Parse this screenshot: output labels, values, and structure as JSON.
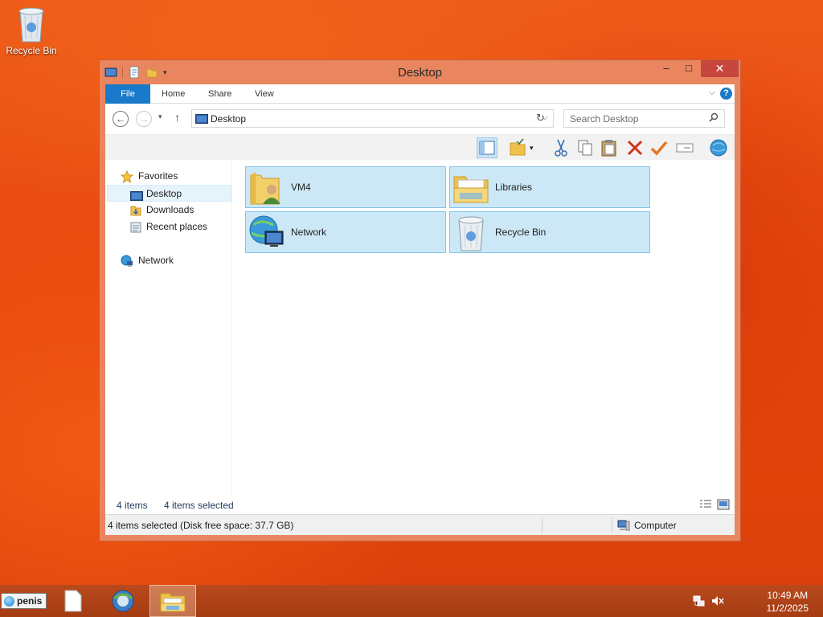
{
  "desktop": {
    "icons": [
      {
        "label": "Recycle Bin",
        "icon": "recycle-bin-icon"
      }
    ]
  },
  "window": {
    "title": "Desktop",
    "controls": {
      "minimize": "–",
      "maximize": "□",
      "close": "✕"
    },
    "ribbon": {
      "tabs": [
        "File",
        "Home",
        "Share",
        "View"
      ],
      "help": "?",
      "expand": "⌵"
    },
    "nav": {
      "back": "←",
      "forward": "→",
      "recent": "▾",
      "up": "↑",
      "address": "Desktop",
      "search_placeholder": "Search Desktop"
    },
    "sidebar": {
      "items": [
        {
          "label": "Favorites",
          "icon": "star-icon"
        },
        {
          "label": "Desktop",
          "icon": "desktop-icon",
          "selected": true
        },
        {
          "label": "Downloads",
          "icon": "downloads-icon"
        },
        {
          "label": "Recent places",
          "icon": "recent-places-icon"
        },
        {
          "label": "Network",
          "icon": "network-icon"
        }
      ]
    },
    "items": [
      {
        "name": "VM4",
        "icon": "user-folder-icon",
        "selected": true
      },
      {
        "name": "Libraries",
        "icon": "libraries-icon",
        "selected": true
      },
      {
        "name": "Network",
        "icon": "network-globe-icon",
        "selected": true
      },
      {
        "name": "Recycle Bin",
        "icon": "recycle-bin-icon",
        "selected": true
      }
    ],
    "status": {
      "count": "4 items",
      "selected": "4 items selected",
      "detail": "4 items selected (Disk free space: 37.7 GB)",
      "zone": "Computer"
    }
  },
  "taskbar": {
    "start_label": "penis",
    "clock_time": "10:49 AM",
    "clock_date": "11/2/2025"
  },
  "colors": {
    "accent": "#1979ca",
    "selection": "#cce8f6",
    "titlebar": "#e9855f",
    "close": "#c7463d"
  }
}
